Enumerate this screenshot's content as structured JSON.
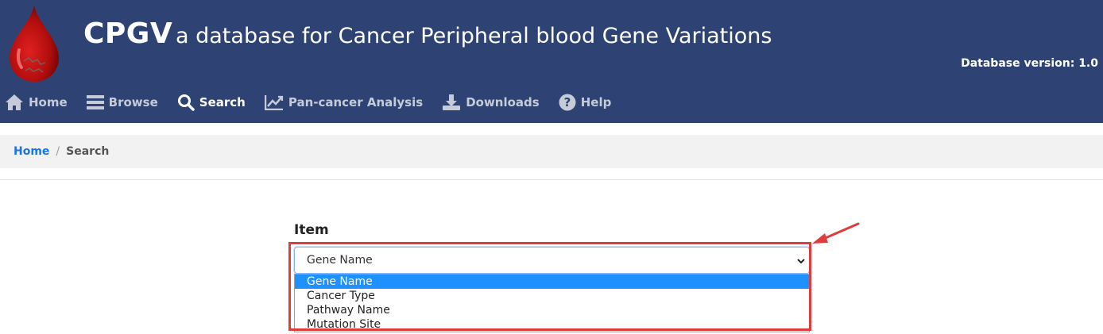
{
  "header": {
    "brand": "CPGV",
    "tagline": "a database for Cancer Peripheral blood Gene Variations",
    "version": "Database version: 1.0",
    "bg_color": "#2e4373"
  },
  "nav": {
    "items": [
      {
        "label": "Home",
        "icon": "home-icon"
      },
      {
        "label": "Browse",
        "icon": "bars-icon"
      },
      {
        "label": "Search",
        "icon": "search-icon",
        "active": true
      },
      {
        "label": "Pan-cancer Analysis",
        "icon": "chart-line-icon"
      },
      {
        "label": "Downloads",
        "icon": "download-icon"
      },
      {
        "label": "Help",
        "icon": "question-circle-icon"
      }
    ]
  },
  "breadcrumb": {
    "home": "Home",
    "separator": "/",
    "current": "Search"
  },
  "form": {
    "item_label": "Item",
    "selected_value": "Gene Name",
    "options": [
      "Gene Name",
      "Cancer Type",
      "Pathway Name",
      "Mutation Site"
    ],
    "highlight_color": "#e03c3c"
  }
}
